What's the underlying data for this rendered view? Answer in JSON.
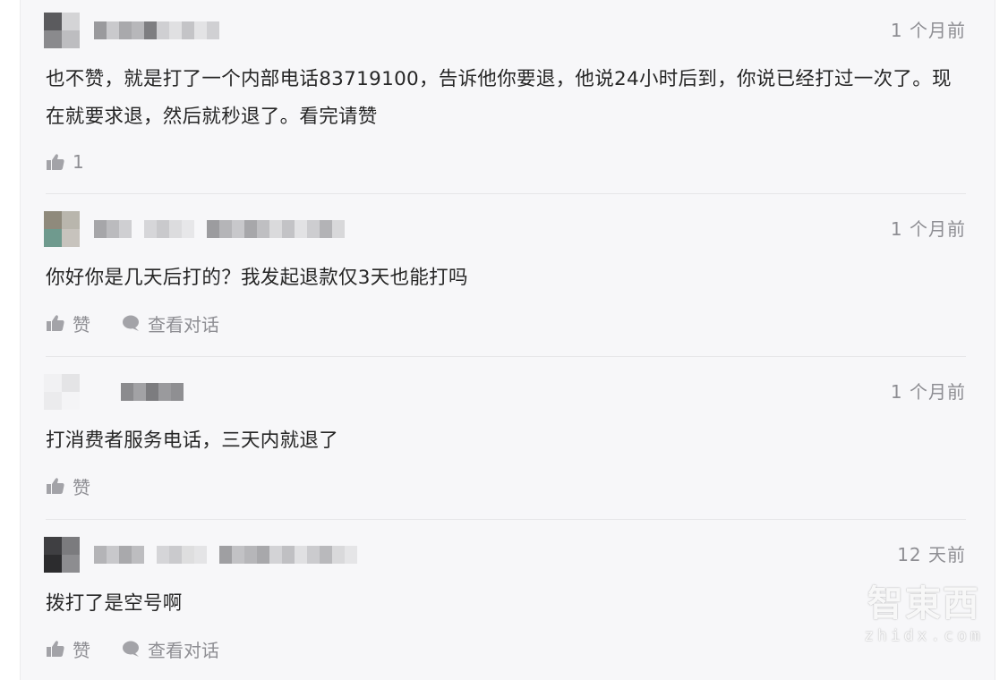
{
  "comments": [
    {
      "time": "1 个月前",
      "text": "也不赞，就是打了一个内部电话83719100，告诉他你要退，他说24小时后到，你说已经打过一次了。现在就要求退，然后就秒退了。看完请赞",
      "like_label": "1",
      "reply_label": ""
    },
    {
      "time": "1 个月前",
      "text": "你好你是几天后打的？我发起退款仅3天也能打吗",
      "like_label": "赞",
      "reply_label": "查看对话"
    },
    {
      "time": "1 个月前",
      "text": "打消费者服务电话，三天内就退了",
      "like_label": "赞",
      "reply_label": ""
    },
    {
      "time": "12 天前",
      "text": "拨打了是空号啊",
      "like_label": "赞",
      "reply_label": "查看对话"
    }
  ],
  "watermark": {
    "logo": "智東西",
    "url": "zhidx.com"
  },
  "colors": {
    "panel_bg": "#f7f7f9",
    "meta_gray": "#8e8e93",
    "text": "#262626"
  }
}
